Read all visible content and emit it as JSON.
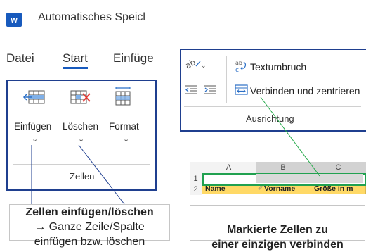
{
  "app": {
    "logo_letter": "w",
    "title": "Automatisches Speicl"
  },
  "tabs": [
    {
      "label": "Datei"
    },
    {
      "label": "Start"
    },
    {
      "label": "Einfüge"
    }
  ],
  "cells_group": {
    "buttons": [
      {
        "label": "Einfügen",
        "icon": "insert-cells-icon"
      },
      {
        "label": "Löschen",
        "icon": "delete-cells-icon"
      },
      {
        "label": "Format",
        "icon": "format-cells-icon"
      }
    ],
    "group_label": "Zellen"
  },
  "align_group": {
    "wrap_text": "Textumbruch",
    "merge_center": "Verbinden und zentrieren",
    "group_label": "Ausrichtung"
  },
  "sheet": {
    "columns": [
      "A",
      "B",
      "C"
    ],
    "rows": [
      "1",
      "2"
    ],
    "header_cells": [
      "Name",
      "Vorname",
      "Größe in m"
    ]
  },
  "callouts": {
    "left": {
      "title": "Zellen einfügen/löschen",
      "line2": "→ Ganze Zeile/Spalte",
      "line3": "einfügen bzw. löschen"
    },
    "right": {
      "line1": "Markierte Zellen zu",
      "line2": "einer einzigen verbinden"
    }
  },
  "colors": {
    "blue_border": "#1f3f8f",
    "connector_green": "#1ea845",
    "header_fill": "#ffd966",
    "selection_green": "#21a150",
    "word_blue": "#185abd"
  }
}
